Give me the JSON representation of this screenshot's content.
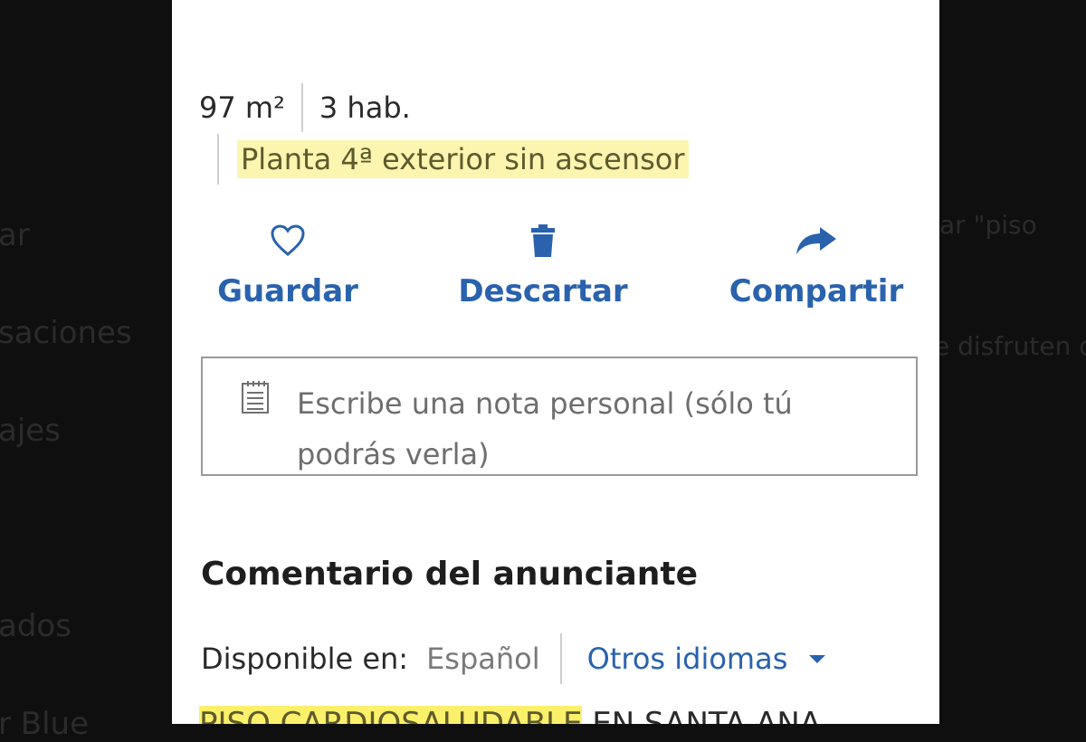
{
  "background": {
    "left_fragments": [
      "ar",
      "saciones",
      "ajes",
      "ados",
      "r Blue"
    ],
    "right_fragments": [
      "ar \"piso",
      "e disfruten d"
    ]
  },
  "features": {
    "area": "97 m²",
    "rooms": "3 hab.",
    "floor": "Planta 4ª exterior sin ascensor"
  },
  "actions": {
    "save": "Guardar",
    "discard": "Descartar",
    "share": "Compartir"
  },
  "note": {
    "placeholder": "Escribe una nota personal (sólo tú podrás verla)"
  },
  "comment": {
    "heading": "Comentario del anunciante",
    "available_label": "Disponible en:",
    "current_language": "Español",
    "other_languages": "Otros idiomas",
    "description_highlight": "PISO CARDIOSALUDABLE",
    "description_rest": " EN SANTA ANA"
  },
  "colors": {
    "accent": "#2a62ad",
    "highlight": "#fbf5b0"
  }
}
